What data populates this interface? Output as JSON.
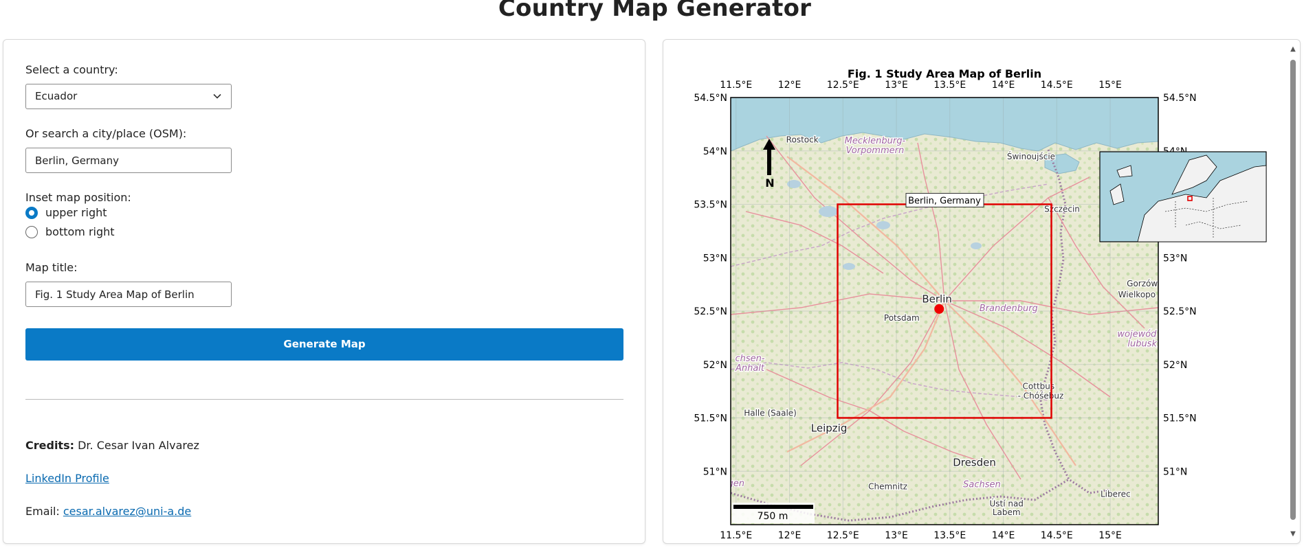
{
  "page": {
    "title": "Country Map Generator"
  },
  "form": {
    "country_label": "Select a country:",
    "country_value": "Ecuador",
    "city_label": "Or search a city/place (OSM):",
    "city_value": "Berlin, Germany",
    "inset_label": "Inset map position:",
    "inset_options": [
      {
        "label": "upper right",
        "selected": true
      },
      {
        "label": "bottom right",
        "selected": false
      }
    ],
    "title_label": "Map title:",
    "title_value": "Fig. 1 Study Area Map of Berlin",
    "generate_label": "Generate Map"
  },
  "credits": {
    "credits_label": "Credits:",
    "credits_name": "Dr. Cesar Ivan Alvarez",
    "linkedin_label": "LinkedIn Profile",
    "email_label": "Email:",
    "email_value": "cesar.alvarez@uni-a.de"
  },
  "map": {
    "title": "Fig. 1 Study Area Map of Berlin",
    "lon_ticks": [
      "11.5°E",
      "12°E",
      "12.5°E",
      "13°E",
      "13.5°E",
      "14°E",
      "14.5°E",
      "15°E"
    ],
    "lat_ticks": [
      "54.5°N",
      "54°N",
      "53.5°N",
      "53°N",
      "52.5°N",
      "52°N",
      "51.5°N",
      "51°N"
    ],
    "north_label": "N",
    "scale_label": "750 m",
    "study_area_label": "Berlin, Germany",
    "marker_lon": 13.4,
    "marker_lat": 52.52,
    "extent": {
      "lon": [
        11.45,
        15.45
      ],
      "lat": [
        50.5,
        54.5
      ]
    },
    "study_box": {
      "lon": [
        12.45,
        14.45
      ],
      "lat": [
        51.5,
        53.5
      ]
    },
    "place_labels": [
      {
        "name": "Rostock",
        "lon": 12.12,
        "lat": 54.08,
        "style": "city"
      },
      {
        "name": "Mecklenburg-",
        "lon": 12.8,
        "lat": 54.07,
        "style": "region"
      },
      {
        "name": "Vorpommern",
        "lon": 12.8,
        "lat": 53.98,
        "style": "region"
      },
      {
        "name": "Świnoujście",
        "lon": 14.26,
        "lat": 53.92,
        "style": "city"
      },
      {
        "name": "Szczecin",
        "lon": 14.55,
        "lat": 53.43,
        "style": "city"
      },
      {
        "name": "Berlin",
        "lon": 13.38,
        "lat": 52.58,
        "style": "bigcity"
      },
      {
        "name": "Potsdam",
        "lon": 13.05,
        "lat": 52.41,
        "style": "city"
      },
      {
        "name": "Brandenburg",
        "lon": 14.05,
        "lat": 52.5,
        "style": "region"
      },
      {
        "name": "Gorzów",
        "lon": 15.3,
        "lat": 52.73,
        "style": "city"
      },
      {
        "name": "Wielkopo",
        "lon": 15.25,
        "lat": 52.63,
        "style": "city"
      },
      {
        "name": "wojewód",
        "lon": 15.25,
        "lat": 52.26,
        "style": "region"
      },
      {
        "name": "lubusk",
        "lon": 15.3,
        "lat": 52.17,
        "style": "region"
      },
      {
        "name": "chsen-",
        "lon": 11.63,
        "lat": 52.03,
        "style": "region"
      },
      {
        "name": "Anhalt",
        "lon": 11.63,
        "lat": 51.94,
        "style": "region"
      },
      {
        "name": "Cottbus",
        "lon": 14.33,
        "lat": 51.77,
        "style": "city"
      },
      {
        "name": "- Chóśebuz",
        "lon": 14.35,
        "lat": 51.68,
        "style": "city"
      },
      {
        "name": "Halle (Saale)",
        "lon": 11.82,
        "lat": 51.52,
        "style": "city"
      },
      {
        "name": "Leipzig",
        "lon": 12.37,
        "lat": 51.37,
        "style": "bigcity"
      },
      {
        "name": "Dresden",
        "lon": 13.73,
        "lat": 51.05,
        "style": "bigcity"
      },
      {
        "name": "Sachsen",
        "lon": 13.8,
        "lat": 50.85,
        "style": "region"
      },
      {
        "name": "Chemnitz",
        "lon": 12.92,
        "lat": 50.83,
        "style": "city"
      },
      {
        "name": "gen",
        "lon": 11.5,
        "lat": 50.86,
        "style": "region"
      },
      {
        "name": "Ústí nad",
        "lon": 14.03,
        "lat": 50.67,
        "style": "city"
      },
      {
        "name": "Labem",
        "lon": 14.03,
        "lat": 50.59,
        "style": "city"
      },
      {
        "name": "Liberec",
        "lon": 15.05,
        "lat": 50.76,
        "style": "city"
      }
    ]
  }
}
